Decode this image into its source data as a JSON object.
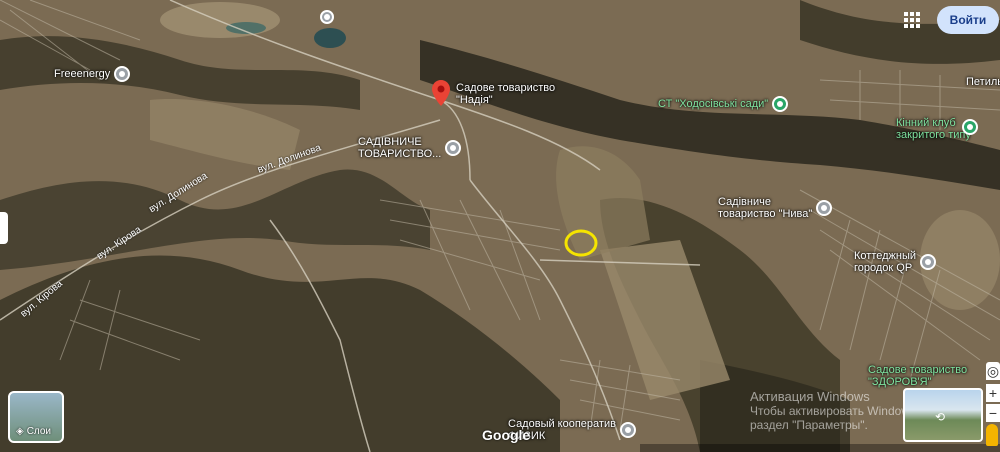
{
  "header": {
    "signin_label": "Войти"
  },
  "pois": [
    {
      "label": "Freeenergy"
    },
    {
      "label": "Садове товариство\n\"Надія\""
    },
    {
      "label": "САДІВНИЧЕ\nТОВАРИСТВО..."
    },
    {
      "label": "СТ \"Ходосівські сади\""
    },
    {
      "label": "Кінний клуб\nзакритого типу"
    },
    {
      "label": "Садівниче\nтовариство \"Нива\""
    },
    {
      "label": "Коттеджный\nгородок QP"
    },
    {
      "label": "Садове товариство\n\"ЗДОРОВ'Я\""
    },
    {
      "label": "Садовый кооператив\nФИЗИК"
    },
    {
      "label": "Петиль"
    }
  ],
  "streets": [
    {
      "label": "вул. Долинова"
    },
    {
      "label": "вул. Долинова"
    },
    {
      "label": "вул. Кірова"
    },
    {
      "label": "вул. Кірова"
    }
  ],
  "controls": {
    "layers_label": "Слои",
    "google_logo": "Google",
    "zoom_in": "+",
    "zoom_out": "−"
  },
  "watermark": {
    "line1": "Активация Windows",
    "line2": "Чтобы активировать Windows,",
    "line3": "раздел \"Параметры\"."
  },
  "icons": [
    "apps-grid-icon",
    "layers-icon",
    "location-pin-icon",
    "pegman-icon",
    "street-view-icon",
    "train-icon"
  ],
  "colors": {
    "signin_bg": "#d2e3fc",
    "marker": "#ea4335",
    "highlight_circle": "#f5e400",
    "green_poi": "#2aa668"
  }
}
